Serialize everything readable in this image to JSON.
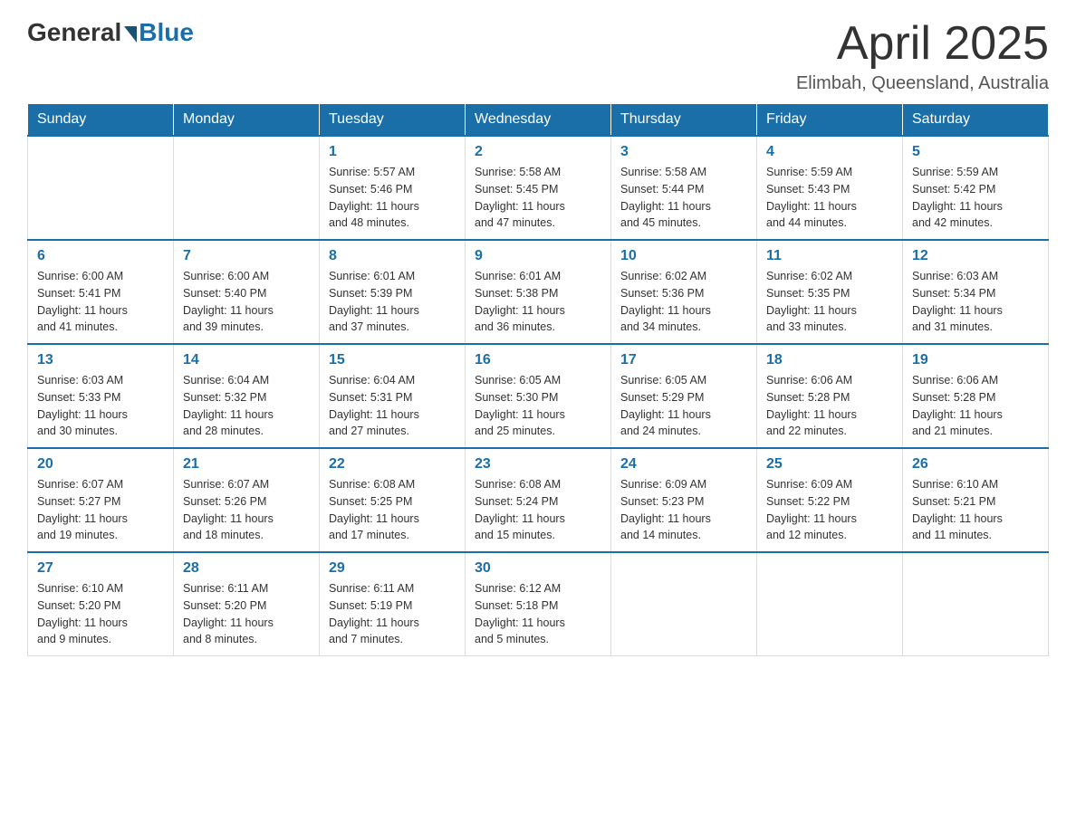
{
  "logo": {
    "general": "General",
    "blue": "Blue"
  },
  "header": {
    "title": "April 2025",
    "location": "Elimbah, Queensland, Australia"
  },
  "days_of_week": [
    "Sunday",
    "Monday",
    "Tuesday",
    "Wednesday",
    "Thursday",
    "Friday",
    "Saturday"
  ],
  "weeks": [
    [
      {
        "day": "",
        "info": ""
      },
      {
        "day": "",
        "info": ""
      },
      {
        "day": "1",
        "info": "Sunrise: 5:57 AM\nSunset: 5:46 PM\nDaylight: 11 hours\nand 48 minutes."
      },
      {
        "day": "2",
        "info": "Sunrise: 5:58 AM\nSunset: 5:45 PM\nDaylight: 11 hours\nand 47 minutes."
      },
      {
        "day": "3",
        "info": "Sunrise: 5:58 AM\nSunset: 5:44 PM\nDaylight: 11 hours\nand 45 minutes."
      },
      {
        "day": "4",
        "info": "Sunrise: 5:59 AM\nSunset: 5:43 PM\nDaylight: 11 hours\nand 44 minutes."
      },
      {
        "day": "5",
        "info": "Sunrise: 5:59 AM\nSunset: 5:42 PM\nDaylight: 11 hours\nand 42 minutes."
      }
    ],
    [
      {
        "day": "6",
        "info": "Sunrise: 6:00 AM\nSunset: 5:41 PM\nDaylight: 11 hours\nand 41 minutes."
      },
      {
        "day": "7",
        "info": "Sunrise: 6:00 AM\nSunset: 5:40 PM\nDaylight: 11 hours\nand 39 minutes."
      },
      {
        "day": "8",
        "info": "Sunrise: 6:01 AM\nSunset: 5:39 PM\nDaylight: 11 hours\nand 37 minutes."
      },
      {
        "day": "9",
        "info": "Sunrise: 6:01 AM\nSunset: 5:38 PM\nDaylight: 11 hours\nand 36 minutes."
      },
      {
        "day": "10",
        "info": "Sunrise: 6:02 AM\nSunset: 5:36 PM\nDaylight: 11 hours\nand 34 minutes."
      },
      {
        "day": "11",
        "info": "Sunrise: 6:02 AM\nSunset: 5:35 PM\nDaylight: 11 hours\nand 33 minutes."
      },
      {
        "day": "12",
        "info": "Sunrise: 6:03 AM\nSunset: 5:34 PM\nDaylight: 11 hours\nand 31 minutes."
      }
    ],
    [
      {
        "day": "13",
        "info": "Sunrise: 6:03 AM\nSunset: 5:33 PM\nDaylight: 11 hours\nand 30 minutes."
      },
      {
        "day": "14",
        "info": "Sunrise: 6:04 AM\nSunset: 5:32 PM\nDaylight: 11 hours\nand 28 minutes."
      },
      {
        "day": "15",
        "info": "Sunrise: 6:04 AM\nSunset: 5:31 PM\nDaylight: 11 hours\nand 27 minutes."
      },
      {
        "day": "16",
        "info": "Sunrise: 6:05 AM\nSunset: 5:30 PM\nDaylight: 11 hours\nand 25 minutes."
      },
      {
        "day": "17",
        "info": "Sunrise: 6:05 AM\nSunset: 5:29 PM\nDaylight: 11 hours\nand 24 minutes."
      },
      {
        "day": "18",
        "info": "Sunrise: 6:06 AM\nSunset: 5:28 PM\nDaylight: 11 hours\nand 22 minutes."
      },
      {
        "day": "19",
        "info": "Sunrise: 6:06 AM\nSunset: 5:28 PM\nDaylight: 11 hours\nand 21 minutes."
      }
    ],
    [
      {
        "day": "20",
        "info": "Sunrise: 6:07 AM\nSunset: 5:27 PM\nDaylight: 11 hours\nand 19 minutes."
      },
      {
        "day": "21",
        "info": "Sunrise: 6:07 AM\nSunset: 5:26 PM\nDaylight: 11 hours\nand 18 minutes."
      },
      {
        "day": "22",
        "info": "Sunrise: 6:08 AM\nSunset: 5:25 PM\nDaylight: 11 hours\nand 17 minutes."
      },
      {
        "day": "23",
        "info": "Sunrise: 6:08 AM\nSunset: 5:24 PM\nDaylight: 11 hours\nand 15 minutes."
      },
      {
        "day": "24",
        "info": "Sunrise: 6:09 AM\nSunset: 5:23 PM\nDaylight: 11 hours\nand 14 minutes."
      },
      {
        "day": "25",
        "info": "Sunrise: 6:09 AM\nSunset: 5:22 PM\nDaylight: 11 hours\nand 12 minutes."
      },
      {
        "day": "26",
        "info": "Sunrise: 6:10 AM\nSunset: 5:21 PM\nDaylight: 11 hours\nand 11 minutes."
      }
    ],
    [
      {
        "day": "27",
        "info": "Sunrise: 6:10 AM\nSunset: 5:20 PM\nDaylight: 11 hours\nand 9 minutes."
      },
      {
        "day": "28",
        "info": "Sunrise: 6:11 AM\nSunset: 5:20 PM\nDaylight: 11 hours\nand 8 minutes."
      },
      {
        "day": "29",
        "info": "Sunrise: 6:11 AM\nSunset: 5:19 PM\nDaylight: 11 hours\nand 7 minutes."
      },
      {
        "day": "30",
        "info": "Sunrise: 6:12 AM\nSunset: 5:18 PM\nDaylight: 11 hours\nand 5 minutes."
      },
      {
        "day": "",
        "info": ""
      },
      {
        "day": "",
        "info": ""
      },
      {
        "day": "",
        "info": ""
      }
    ]
  ]
}
